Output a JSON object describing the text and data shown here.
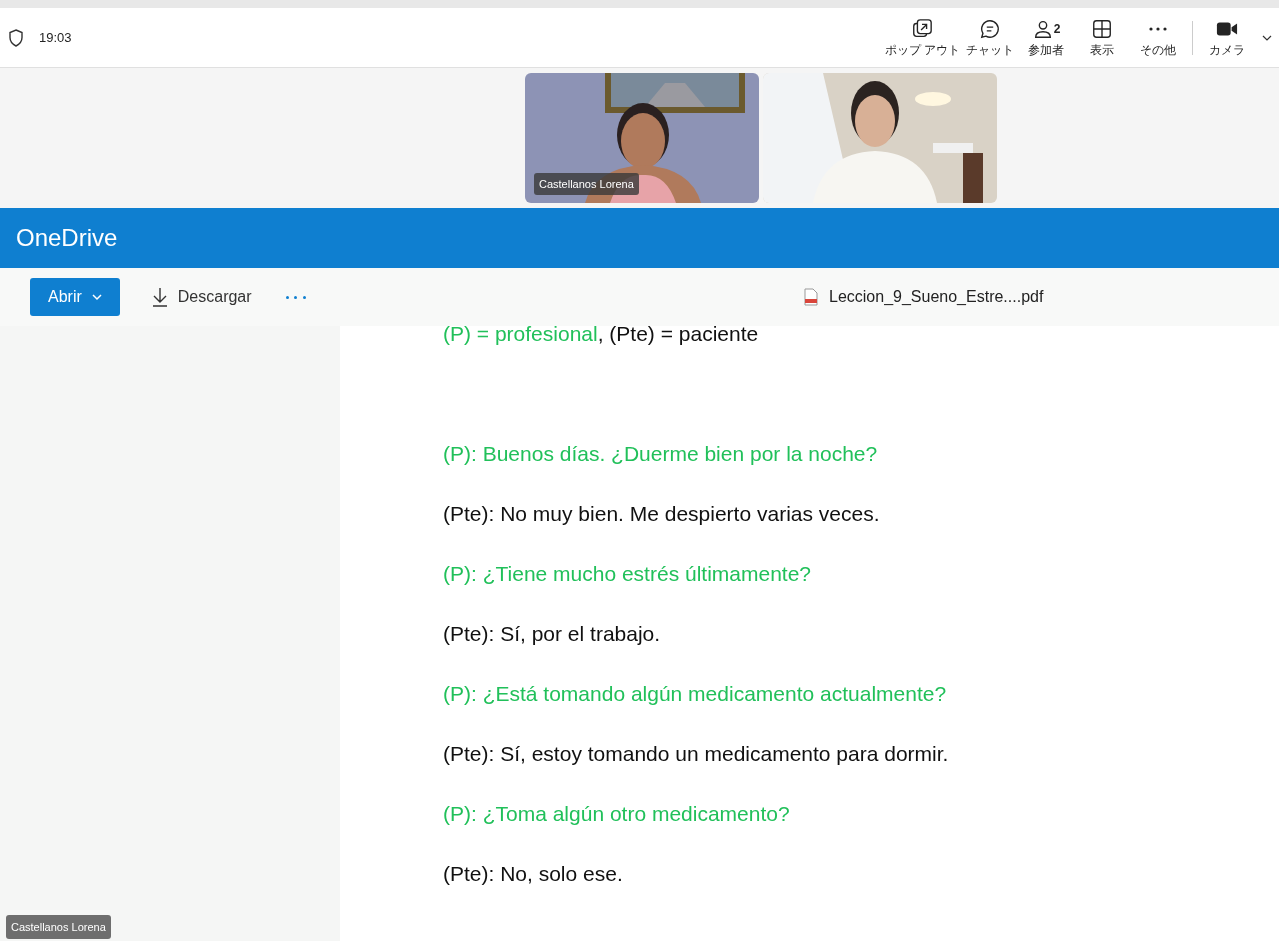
{
  "meeting_bar": {
    "timer": "19:03",
    "actions": [
      {
        "kind": "popout",
        "label": "ポップ アウト"
      },
      {
        "kind": "chat",
        "label": "チャット"
      },
      {
        "kind": "people",
        "label": "参加者",
        "count": "2"
      },
      {
        "kind": "view",
        "label": "表示"
      },
      {
        "kind": "more",
        "label": "その他"
      },
      {
        "kind": "camera",
        "label": "カメラ"
      }
    ]
  },
  "video_tiles": [
    {
      "kind": "picture",
      "name": "Castellanos Lorena"
    },
    {
      "kind": "picture"
    }
  ],
  "viewer": {
    "app_title": "OneDrive",
    "open_button": "Abrir",
    "download_button": "Descargar",
    "file_name": "Leccion_9_Sueno_Estre....pdf"
  },
  "document_lines": [
    {
      "segments": [
        {
          "kind": "professional",
          "text": "(P) = profesional"
        },
        {
          "kind": "patient",
          "text": ", (Pte) = paciente"
        }
      ]
    },
    {
      "segments": [
        {
          "kind": "professional",
          "text": "(P): Buenos días. ¿Duerme bien por la noche?"
        }
      ]
    },
    {
      "segments": [
        {
          "kind": "patient",
          "text": "(Pte): No muy bien. Me despierto varias veces."
        }
      ]
    },
    {
      "segments": [
        {
          "kind": "professional",
          "text": "(P): ¿Tiene mucho estrés últimamente?"
        }
      ]
    },
    {
      "segments": [
        {
          "kind": "patient",
          "text": "(Pte): Sí, por el trabajo."
        }
      ]
    },
    {
      "segments": [
        {
          "kind": "professional",
          "text": "(P): ¿Está tomando algún medicamento actualmente?"
        }
      ]
    },
    {
      "segments": [
        {
          "kind": "patient",
          "text": "(Pte): Sí, estoy tomando un medicamento para dormir."
        }
      ]
    },
    {
      "segments": [
        {
          "kind": "professional",
          "text": "(P): ¿Toma algún otro medicamento?"
        }
      ]
    },
    {
      "segments": [
        {
          "kind": "patient",
          "text": "(Pte): No, solo ese."
        }
      ]
    }
  ],
  "presenter_tag": "Castellanos Lorena"
}
